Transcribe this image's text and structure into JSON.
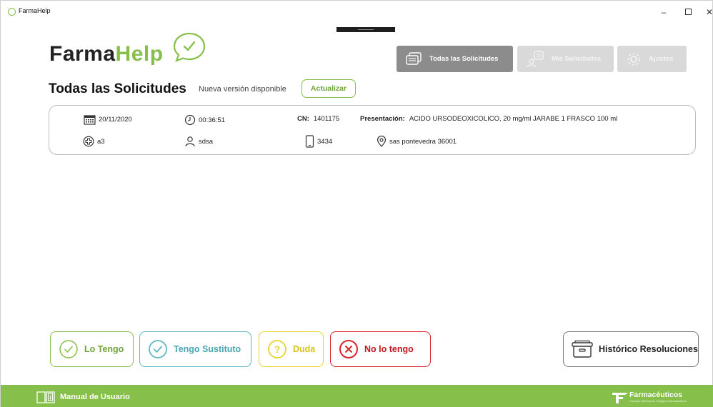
{
  "window": {
    "title": "FarmaHelp"
  },
  "logo": {
    "part1": "Farma",
    "part2": "Help"
  },
  "nav": {
    "todas": "Todas las Solicitudes",
    "mis": "Mis Solicitudes",
    "ajustes": "Ajustes"
  },
  "page": {
    "title": "Todas las Solicitudes",
    "version_text": "Nueva versión disponible",
    "update_label": "Actualizar"
  },
  "request": {
    "date": "20/11/2020",
    "time": "00:36:51",
    "cn_label": "CN:",
    "cn_value": "1401175",
    "presentation_label": "Presentación:",
    "presentation_value": "ACIDO URSODEOXICOLICO, 20 mg/ml JARABE 1 FRASCO 100 ml",
    "pharmacy": "a3",
    "user": "sdsa",
    "phone": "3434",
    "location": "sas pontevedra 36001"
  },
  "actions": {
    "lo_tengo": "Lo Tengo",
    "sustituto": "Tengo Sustituto",
    "duda": "Duda",
    "no_tengo": "No lo tengo",
    "historico": "Histórico Resoluciones"
  },
  "footer": {
    "manual": "Manual de Usuario",
    "org_name": "Farmacéuticos",
    "org_sub": "Consejo General de Colegios Farmacéuticos"
  },
  "colors": {
    "brand_green": "#86c04a",
    "teal": "#5fb8c4",
    "yellow": "#e8d530",
    "red": "#d9242b",
    "nav_active": "#8c8c8c",
    "nav_inactive": "#d9d9d9"
  },
  "icons": {
    "date": "calendar-icon",
    "time": "clock-icon",
    "pharmacy": "cross-circle-icon",
    "user": "person-icon",
    "phone": "phone-icon",
    "location": "location-pin-icon"
  }
}
